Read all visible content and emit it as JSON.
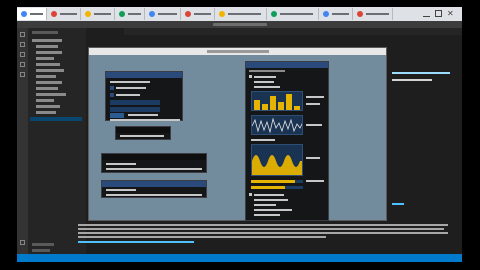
{
  "browser": {
    "tab_favicon_colors": [
      "#4285f4",
      "#db4437",
      "#f4b400",
      "#0f9d58",
      "#4285f4",
      "#db4437",
      "#f4b400",
      "#0f9d58",
      "#4285f4",
      "#db4437"
    ]
  },
  "ide": {
    "editor_tabs": [],
    "status_left": "",
    "status_right": ""
  },
  "imgui": {
    "windows": [
      {
        "name": "hello-window"
      },
      {
        "name": "second-window"
      },
      {
        "name": "third-window"
      },
      {
        "name": "fourth-window"
      },
      {
        "name": "demo-window"
      }
    ]
  },
  "colors": {
    "accent": "#007acc",
    "imgui_title": "#294a7a",
    "imgui_plot": "#e6b400",
    "app_bg": "#728c9e"
  }
}
